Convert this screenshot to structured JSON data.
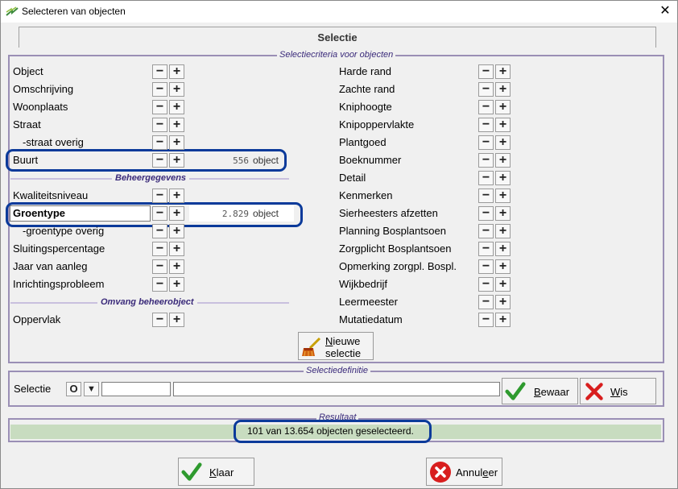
{
  "window": {
    "title": "Selecteren van objecten",
    "close_glyph": "✕"
  },
  "tab": {
    "label": "Selectie"
  },
  "criteria_group": {
    "label": "Selectiecriteria voor objecten"
  },
  "left_items_top": [
    {
      "label": "Object"
    },
    {
      "label": "Omschrijving"
    },
    {
      "label": "Woonplaats"
    },
    {
      "label": "Straat"
    },
    {
      "label": "-straat overig"
    },
    {
      "label": "Buurt",
      "count": "556",
      "unit": "object"
    }
  ],
  "beheer_heading": "Beheergegevens",
  "left_items_beheer": [
    {
      "label": "Kwaliteitsniveau"
    },
    {
      "label": "Groentype",
      "count": "2.829",
      "unit": "object"
    },
    {
      "label": "-groentype overig"
    },
    {
      "label": "Sluitingspercentage"
    },
    {
      "label": "Jaar van aanleg"
    },
    {
      "label": "Inrichtingsprobleem"
    }
  ],
  "omvang_heading": "Omvang beheerobject",
  "left_items_omvang": [
    {
      "label": "Oppervlak"
    }
  ],
  "right_items": [
    {
      "label": "Harde rand"
    },
    {
      "label": "Zachte rand"
    },
    {
      "label": "Kniphoogte"
    },
    {
      "label": "Knipoppervlakte"
    },
    {
      "label": "Plantgoed"
    },
    {
      "label": "Boeknummer"
    },
    {
      "label": "Detail"
    },
    {
      "label": "Kenmerken"
    },
    {
      "label": "Sierheesters afzetten"
    },
    {
      "label": "Planning Bosplantsoen"
    },
    {
      "label": "Zorgplicht Bosplantsoen"
    },
    {
      "label": "Opmerking zorgpl. Bospl."
    },
    {
      "label": "Wijkbedrijf"
    },
    {
      "label": "Leermeester"
    },
    {
      "label": "Mutatiedatum"
    }
  ],
  "minus_glyph": "−",
  "plus_glyph": "+",
  "new_selection": {
    "line1": "Nieuwe",
    "line2": "selectie",
    "icon": "broom-icon"
  },
  "definition_group": {
    "label": "Selectiedefinitie",
    "field_label": "Selectie",
    "o_button": "O",
    "dropdown_glyph": "▼",
    "name_value": "",
    "desc_value": "",
    "save_label": "Bewaar",
    "clear_label": "Wis"
  },
  "result_group": {
    "label": "Resultaat",
    "text": "101 van 13.654 objecten geselecteerd."
  },
  "footer": {
    "ok_label": "Klaar",
    "cancel_label": "Annuleer"
  },
  "colors": {
    "result_bg": "#c8dcc0",
    "highlight": "#0b3a9a",
    "group_border": "#9a8fb5",
    "check": "#2e9a2e",
    "cross": "#d81e1e"
  }
}
